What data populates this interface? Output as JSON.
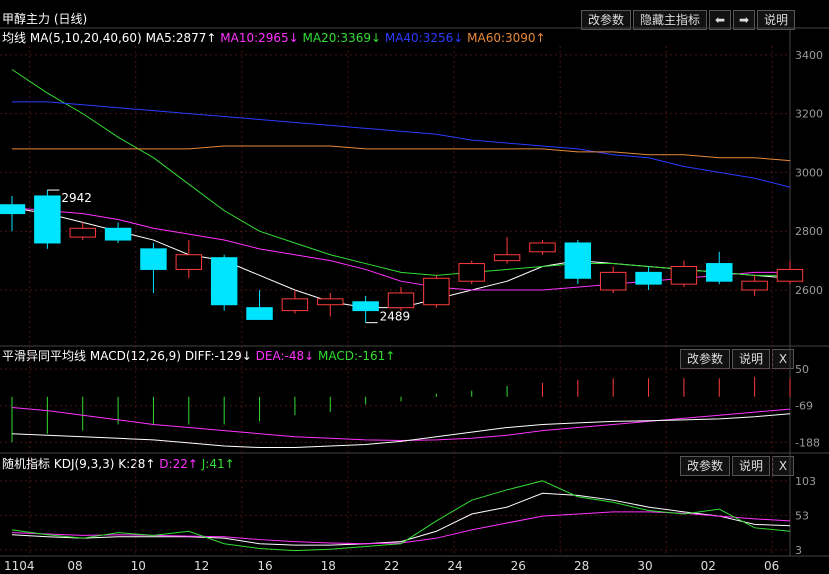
{
  "header": {
    "title": "甲醇主力 (日线)",
    "buttons": {
      "change_params": "改参数",
      "hide_indicator": "隐藏主指标",
      "left_icon": "arrow-left-icon",
      "right_icon": "arrow-right-icon",
      "explain": "说明"
    }
  },
  "main_legend": {
    "label": "均线",
    "params": "MA(5,10,20,40,60)",
    "ma5": "MA5:2877↑",
    "ma10": "MA10:2965↓",
    "ma20": "MA20:3369↓",
    "ma40": "MA40:3256↓",
    "ma60": "MA60:3090↑"
  },
  "macd_legend": {
    "label": "平滑异同平均线",
    "params": "MACD(12,26,9)",
    "diff": "DIFF:-129↓",
    "dea": "DEA:-48↓",
    "macd": "MACD:-161↑",
    "btn_params": "改参数",
    "btn_explain": "说明",
    "btn_close": "X"
  },
  "kdj_legend": {
    "label": "随机指标",
    "params": "KDJ(9,3,3)",
    "k": "K:28↑",
    "d": "D:22↑",
    "j": "J:41↑",
    "btn_params": "改参数",
    "btn_explain": "说明",
    "btn_close": "X"
  },
  "colors": {
    "up": "#ff3b3b",
    "down": "#00e5ff",
    "ma5": "#ffffff",
    "ma10": "#ff33ff",
    "ma20": "#33dd33",
    "ma40": "#2b3bff",
    "ma60": "#e88a3a",
    "grid": "#4a1414",
    "axis": "#9a9a9a"
  },
  "chart_data": [
    {
      "type": "candlestick",
      "x_labels": [
        "1104",
        "08",
        "10",
        "12",
        "16",
        "18",
        "22",
        "24",
        "26",
        "28",
        "30",
        "02",
        "06"
      ],
      "ylim": [
        2430,
        3430
      ],
      "y_ticks": [
        2600,
        2800,
        3000,
        3200,
        3400
      ],
      "annotations": [
        {
          "text": "2942",
          "index": 1
        },
        {
          "text": "2489",
          "index": 10
        }
      ],
      "candles": [
        {
          "o": 2890,
          "h": 2920,
          "l": 2800,
          "c": 2860
        },
        {
          "o": 2920,
          "h": 2940,
          "l": 2740,
          "c": 2760
        },
        {
          "o": 2780,
          "h": 2830,
          "l": 2770,
          "c": 2810
        },
        {
          "o": 2810,
          "h": 2830,
          "l": 2760,
          "c": 2770
        },
        {
          "o": 2740,
          "h": 2760,
          "l": 2590,
          "c": 2670
        },
        {
          "o": 2670,
          "h": 2770,
          "l": 2640,
          "c": 2720
        },
        {
          "o": 2710,
          "h": 2720,
          "l": 2530,
          "c": 2550
        },
        {
          "o": 2540,
          "h": 2600,
          "l": 2500,
          "c": 2500
        },
        {
          "o": 2530,
          "h": 2600,
          "l": 2520,
          "c": 2570
        },
        {
          "o": 2550,
          "h": 2590,
          "l": 2510,
          "c": 2570
        },
        {
          "o": 2560,
          "h": 2580,
          "l": 2489,
          "c": 2530
        },
        {
          "o": 2540,
          "h": 2610,
          "l": 2530,
          "c": 2590
        },
        {
          "o": 2550,
          "h": 2650,
          "l": 2540,
          "c": 2640
        },
        {
          "o": 2630,
          "h": 2700,
          "l": 2620,
          "c": 2690
        },
        {
          "o": 2700,
          "h": 2780,
          "l": 2690,
          "c": 2720
        },
        {
          "o": 2730,
          "h": 2770,
          "l": 2720,
          "c": 2760
        },
        {
          "o": 2760,
          "h": 2770,
          "l": 2620,
          "c": 2640
        },
        {
          "o": 2600,
          "h": 2680,
          "l": 2590,
          "c": 2660
        },
        {
          "o": 2660,
          "h": 2680,
          "l": 2600,
          "c": 2620
        },
        {
          "o": 2620,
          "h": 2700,
          "l": 2610,
          "c": 2680
        },
        {
          "o": 2690,
          "h": 2730,
          "l": 2620,
          "c": 2630
        },
        {
          "o": 2600,
          "h": 2650,
          "l": 2580,
          "c": 2630
        },
        {
          "o": 2630,
          "h": 2700,
          "l": 2620,
          "c": 2670
        }
      ],
      "series": [
        {
          "key": "ma5",
          "values": [
            2880,
            2860,
            2830,
            2800,
            2770,
            2720,
            2700,
            2650,
            2600,
            2560,
            2540,
            2540,
            2570,
            2600,
            2630,
            2680,
            2700,
            2690,
            2680,
            2670,
            2660,
            2650,
            2640
          ]
        },
        {
          "key": "ma10",
          "values": [
            2880,
            2870,
            2860,
            2840,
            2810,
            2790,
            2770,
            2740,
            2720,
            2700,
            2670,
            2630,
            2610,
            2600,
            2600,
            2600,
            2610,
            2620,
            2630,
            2640,
            2650,
            2660,
            2660
          ]
        },
        {
          "key": "ma20",
          "values": [
            3350,
            3270,
            3200,
            3120,
            3050,
            2960,
            2870,
            2800,
            2760,
            2720,
            2690,
            2660,
            2650,
            2660,
            2670,
            2680,
            2690,
            2690,
            2680,
            2670,
            2660,
            2650,
            2650
          ]
        },
        {
          "key": "ma40",
          "values": [
            3240,
            3240,
            3230,
            3220,
            3210,
            3200,
            3190,
            3180,
            3170,
            3160,
            3150,
            3140,
            3130,
            3110,
            3100,
            3090,
            3080,
            3060,
            3050,
            3020,
            3000,
            2980,
            2950
          ]
        },
        {
          "key": "ma60",
          "values": [
            3080,
            3080,
            3080,
            3080,
            3080,
            3080,
            3090,
            3090,
            3090,
            3090,
            3080,
            3080,
            3080,
            3080,
            3080,
            3080,
            3070,
            3070,
            3060,
            3060,
            3050,
            3050,
            3040
          ]
        }
      ]
    },
    {
      "type": "bar",
      "name": "MACD",
      "ylim": [
        -200,
        60
      ],
      "y_ticks": [
        50,
        -69,
        -188
      ],
      "macd": [
        -188,
        -160,
        -150,
        -130,
        -130,
        -130,
        -130,
        -120,
        -100,
        -90,
        -65,
        -55,
        -30,
        -20,
        -5,
        5,
        15,
        20,
        20,
        20,
        20,
        25,
        20
      ],
      "series": [
        {
          "key": "ma10",
          "values": [
            -75,
            -85,
            -100,
            -115,
            -130,
            -140,
            -150,
            -160,
            -170,
            -175,
            -180,
            -182,
            -180,
            -175,
            -165,
            -150,
            -140,
            -130,
            -120,
            -110,
            -100,
            -90,
            -80
          ]
        },
        {
          "key": "ma5",
          "values": [
            -160,
            -165,
            -170,
            -175,
            -180,
            -190,
            -200,
            -205,
            -205,
            -200,
            -195,
            -185,
            -170,
            -155,
            -140,
            -130,
            -125,
            -120,
            -118,
            -115,
            -112,
            -105,
            -95
          ]
        }
      ]
    },
    {
      "type": "line",
      "name": "KDJ",
      "ylim": [
        0,
        110
      ],
      "y_ticks": [
        103,
        53,
        3
      ],
      "series": [
        {
          "key": "ma5",
          "values": [
            25,
            22,
            20,
            22,
            22,
            22,
            20,
            12,
            10,
            10,
            12,
            15,
            30,
            55,
            65,
            85,
            82,
            75,
            65,
            58,
            52,
            40,
            38
          ]
        },
        {
          "key": "ma10",
          "values": [
            28,
            26,
            24,
            25,
            24,
            23,
            22,
            18,
            15,
            13,
            12,
            13,
            20,
            32,
            42,
            52,
            55,
            58,
            58,
            56,
            52,
            48,
            45
          ]
        },
        {
          "key": "ma20",
          "values": [
            32,
            25,
            20,
            28,
            24,
            30,
            12,
            5,
            2,
            4,
            8,
            12,
            45,
            75,
            90,
            103,
            80,
            72,
            60,
            55,
            62,
            35,
            30
          ]
        }
      ]
    }
  ]
}
